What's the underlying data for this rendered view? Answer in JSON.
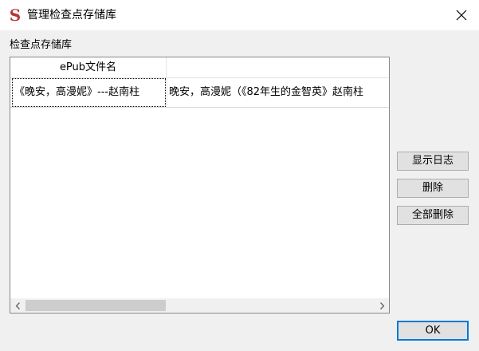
{
  "window": {
    "title": "管理检查点存储库",
    "app_icon": "S",
    "close_icon": "close-icon"
  },
  "repository": {
    "label": "检查点存储库",
    "columns": [
      "ePub文件名",
      ""
    ],
    "rows": [
      {
        "filename": "《晚安，高漫妮》---赵南柱",
        "title": "晚安，高漫妮（《82年生的金智英》赵南柱"
      }
    ]
  },
  "buttons": {
    "show_log": "显示日志",
    "delete": "删除",
    "delete_all": "全部删除",
    "ok": "OK"
  },
  "colors": {
    "focus_border": "#0078d7",
    "icon_red": "#b5373a"
  }
}
